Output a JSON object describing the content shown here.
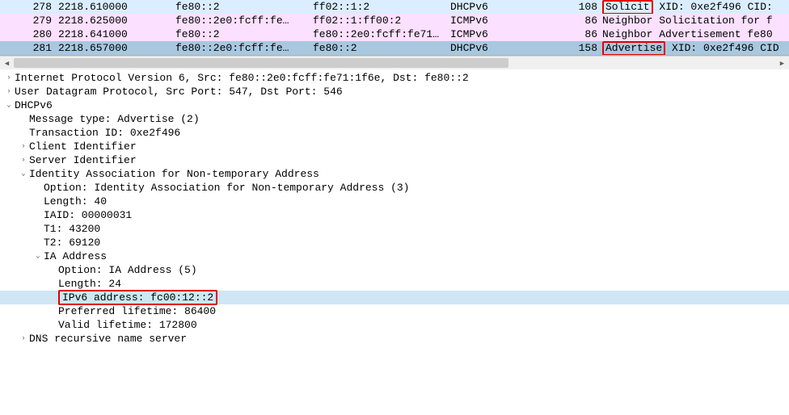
{
  "packets": [
    {
      "no": "278",
      "time": "2218.610000",
      "src": "fe80::2",
      "dst": "ff02::1:2",
      "proto": "DHCPv6",
      "len": "108",
      "info_pre": "",
      "info_box": "Solicit",
      "info_post": " XID: 0xe2f496 CID: ",
      "bg": "bg1"
    },
    {
      "no": "279",
      "time": "2218.625000",
      "src": "fe80::2e0:fcff:fe…",
      "dst": "ff02::1:ff00:2",
      "proto": "ICMPv6",
      "len": "86",
      "info_pre": "Neighbor Solicitation for f",
      "info_box": "",
      "info_post": "",
      "bg": "bg2"
    },
    {
      "no": "280",
      "time": "2218.641000",
      "src": "fe80::2",
      "dst": "fe80::2e0:fcff:fe71…",
      "proto": "ICMPv6",
      "len": "86",
      "info_pre": "Neighbor Advertisement fe80",
      "info_box": "",
      "info_post": "",
      "bg": "bg3"
    },
    {
      "no": "281",
      "time": "2218.657000",
      "src": "fe80::2e0:fcff:fe…",
      "dst": "fe80::2",
      "proto": "DHCPv6",
      "len": "158",
      "info_pre": "",
      "info_box": "Advertise",
      "info_post": " XID: 0xe2f496 CID",
      "bg": "selected"
    }
  ],
  "details": {
    "ipv6_line": "Internet Protocol Version 6, Src: fe80::2e0:fcff:fe71:1f6e, Dst: fe80::2",
    "udp_line": "User Datagram Protocol, Src Port: 547, Dst Port: 546",
    "dhcpv6_label": "DHCPv6",
    "msg_type": "Message type: Advertise (2)",
    "txn_id": "Transaction ID: 0xe2f496",
    "client_id": "Client Identifier",
    "server_id": "Server Identifier",
    "ia_na": "Identity Association for Non-temporary Address",
    "ia_na_option": "Option: Identity Association for Non-temporary Address (3)",
    "ia_na_length": "Length: 40",
    "ia_na_iaid": "IAID: 00000031",
    "ia_na_t1": "T1: 43200",
    "ia_na_t2": "T2: 69120",
    "ia_addr_label": "IA Address",
    "ia_addr_option": "Option: IA Address (5)",
    "ia_addr_length": "Length: 24",
    "ia_addr_ipv6": "IPv6 address: fc00:12::2",
    "ia_addr_pref": "Preferred lifetime: 86400",
    "ia_addr_valid": "Valid lifetime: 172800",
    "dns_label": "DNS recursive name server"
  },
  "toggles": {
    "collapsed": "▶",
    "expanded": "▼",
    "expanded_v": "⌄",
    "right": "›"
  }
}
